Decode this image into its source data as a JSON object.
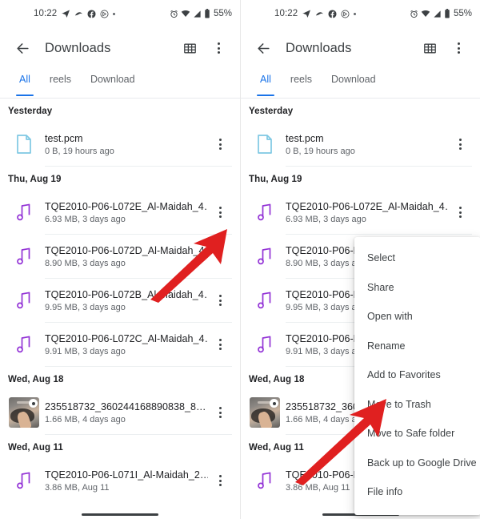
{
  "status_bar": {
    "time": "10:22",
    "left_icons": [
      "telegram-icon",
      "unknown-app-icon",
      "facebook-icon",
      "circle-arrow-icon",
      "more-dot-icon"
    ],
    "right_icons": [
      "alarm-icon",
      "wifi-icon",
      "signal-icon",
      "battery-icon"
    ],
    "battery": "55%"
  },
  "appbar": {
    "back_icon": "back-arrow-icon",
    "title": "Downloads",
    "grid_icon": "grid-view-icon",
    "overflow_icon": "overflow-menu-icon"
  },
  "tabs": [
    {
      "label": "All",
      "active": true
    },
    {
      "label": "reels",
      "active": false
    },
    {
      "label": "Download",
      "active": false
    }
  ],
  "colors": {
    "accent": "#1a73e8",
    "audio_icon": "#9333d6",
    "doc_icon": "#7ec8e3",
    "arrow": "#e02020",
    "text_primary": "#202124",
    "text_secondary": "#5f6368"
  },
  "groups": [
    {
      "date": "Yesterday",
      "files": [
        {
          "name": "test.pcm",
          "details": "0 B, 19 hours ago",
          "icon": "document-icon"
        }
      ]
    },
    {
      "date": "Thu, Aug 19",
      "files": [
        {
          "name": "TQE2010-P06-L072E_Al-Maidah_4…",
          "details": "6.93 MB, 3 days ago",
          "icon": "audio-icon"
        },
        {
          "name": "TQE2010-P06-L072D_Al-Maidah_4…",
          "details": "8.90 MB, 3 days ago",
          "icon": "audio-icon"
        },
        {
          "name": "TQE2010-P06-L072B_Al-Maidah_4…",
          "details": "9.95 MB, 3 days ago",
          "icon": "audio-icon"
        },
        {
          "name": "TQE2010-P06-L072C_Al-Maidah_4…",
          "details": "9.91 MB, 3 days ago",
          "icon": "audio-icon"
        }
      ]
    },
    {
      "date": "Wed, Aug 18",
      "files": [
        {
          "name": "235518732_360244168890838_8…",
          "details": "1.66 MB, 4 days ago",
          "icon": "video-thumbnail"
        }
      ]
    },
    {
      "date": "Wed, Aug 11",
      "files": [
        {
          "name": "TQE2010-P06-L071I_Al-Maidah_2…",
          "details": "3.86 MB, Aug 11",
          "icon": "audio-icon"
        }
      ]
    }
  ],
  "context_menu": {
    "items": [
      "Select",
      "Share",
      "Open with",
      "Rename",
      "Add to Favorites",
      "Move to Trash",
      "Move to Safe folder",
      "Back up to Google Drive",
      "File info"
    ],
    "highlighted": "Move to Trash"
  },
  "annotations": {
    "left_arrow_target": "overflow-menu-icon of TQE2010-P06-L072E_Al-Maidah_4… row",
    "right_arrow_target": "Move to Trash"
  }
}
